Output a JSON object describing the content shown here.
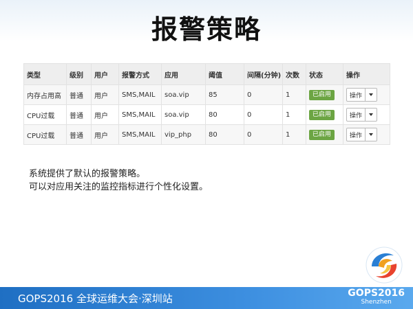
{
  "slide": {
    "title": "报警策略"
  },
  "table": {
    "headers": [
      "类型",
      "级别",
      "用户",
      "报警方式",
      "应用",
      "阈值",
      "间隔(分钟)",
      "次数",
      "状态",
      "操作"
    ],
    "rows": [
      {
        "type": "内存占用高",
        "level": "普通",
        "user": "用户",
        "method": "SMS,MAIL",
        "app": "soa.vip",
        "threshold": "85",
        "interval": "0",
        "count": "1",
        "status": "已启用",
        "action": "操作"
      },
      {
        "type": "CPU过载",
        "level": "普通",
        "user": "用户",
        "method": "SMS,MAIL",
        "app": "soa.vip",
        "threshold": "80",
        "interval": "0",
        "count": "1",
        "status": "已启用",
        "action": "操作"
      },
      {
        "type": "CPU过载",
        "level": "普通",
        "user": "用户",
        "method": "SMS,MAIL",
        "app": "vip_php",
        "threshold": "80",
        "interval": "0",
        "count": "1",
        "status": "已启用",
        "action": "操作"
      }
    ]
  },
  "description": {
    "line1": "系统提供了默认的报警策略。",
    "line2": "可以对应用关注的监控指标进行个性化设置。"
  },
  "footer": {
    "event": "GOPS2016 全球运维大会·深圳站",
    "brand_name": "GOPS2016",
    "brand_city": "Shenzhen"
  },
  "colors": {
    "status_enabled": "#6ca543",
    "footer_blue": "#1f6fc3",
    "header_bg": "#eeeeee"
  },
  "icons": {
    "caret": "chevron-down-icon",
    "logo": "gops-logo-icon"
  }
}
